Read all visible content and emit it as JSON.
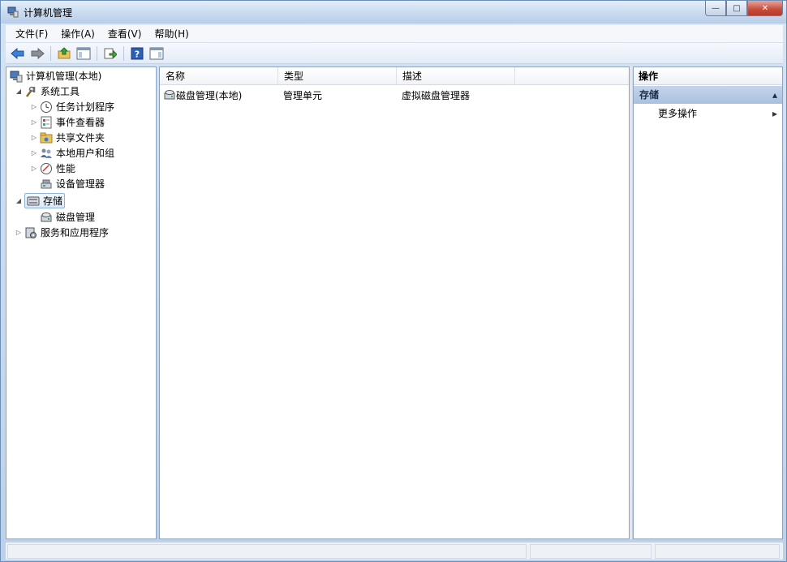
{
  "window": {
    "title": "计算机管理",
    "buttons": {
      "minimize": "—",
      "maximize": "□",
      "close": "✕"
    }
  },
  "menu": [
    "文件(F)",
    "操作(A)",
    "查看(V)",
    "帮助(H)"
  ],
  "toolbar": {
    "icons": [
      "back-icon",
      "forward-icon",
      "up-folder-icon",
      "show-hide-tree-icon",
      "export-list-icon",
      "help-icon",
      "show-hide-action-pane-icon"
    ]
  },
  "tree": {
    "root": "计算机管理(本地)",
    "system_tools": "系统工具",
    "task_scheduler": "任务计划程序",
    "event_viewer": "事件查看器",
    "shared_folders": "共享文件夹",
    "local_users": "本地用户和组",
    "performance": "性能",
    "device_manager": "设备管理器",
    "storage": "存储",
    "disk_management": "磁盘管理",
    "services_apps": "服务和应用程序"
  },
  "list": {
    "headers": [
      "名称",
      "类型",
      "描述"
    ],
    "rows": [
      {
        "name": "磁盘管理(本地)",
        "type": "管理单元",
        "description": "虚拟磁盘管理器"
      }
    ]
  },
  "actions": {
    "header": "操作",
    "section": "存储",
    "more": "更多操作"
  },
  "colors": {
    "accent": "#a9c0de",
    "titlebar": "#c8daf0",
    "close_button": "#c64b3a"
  }
}
